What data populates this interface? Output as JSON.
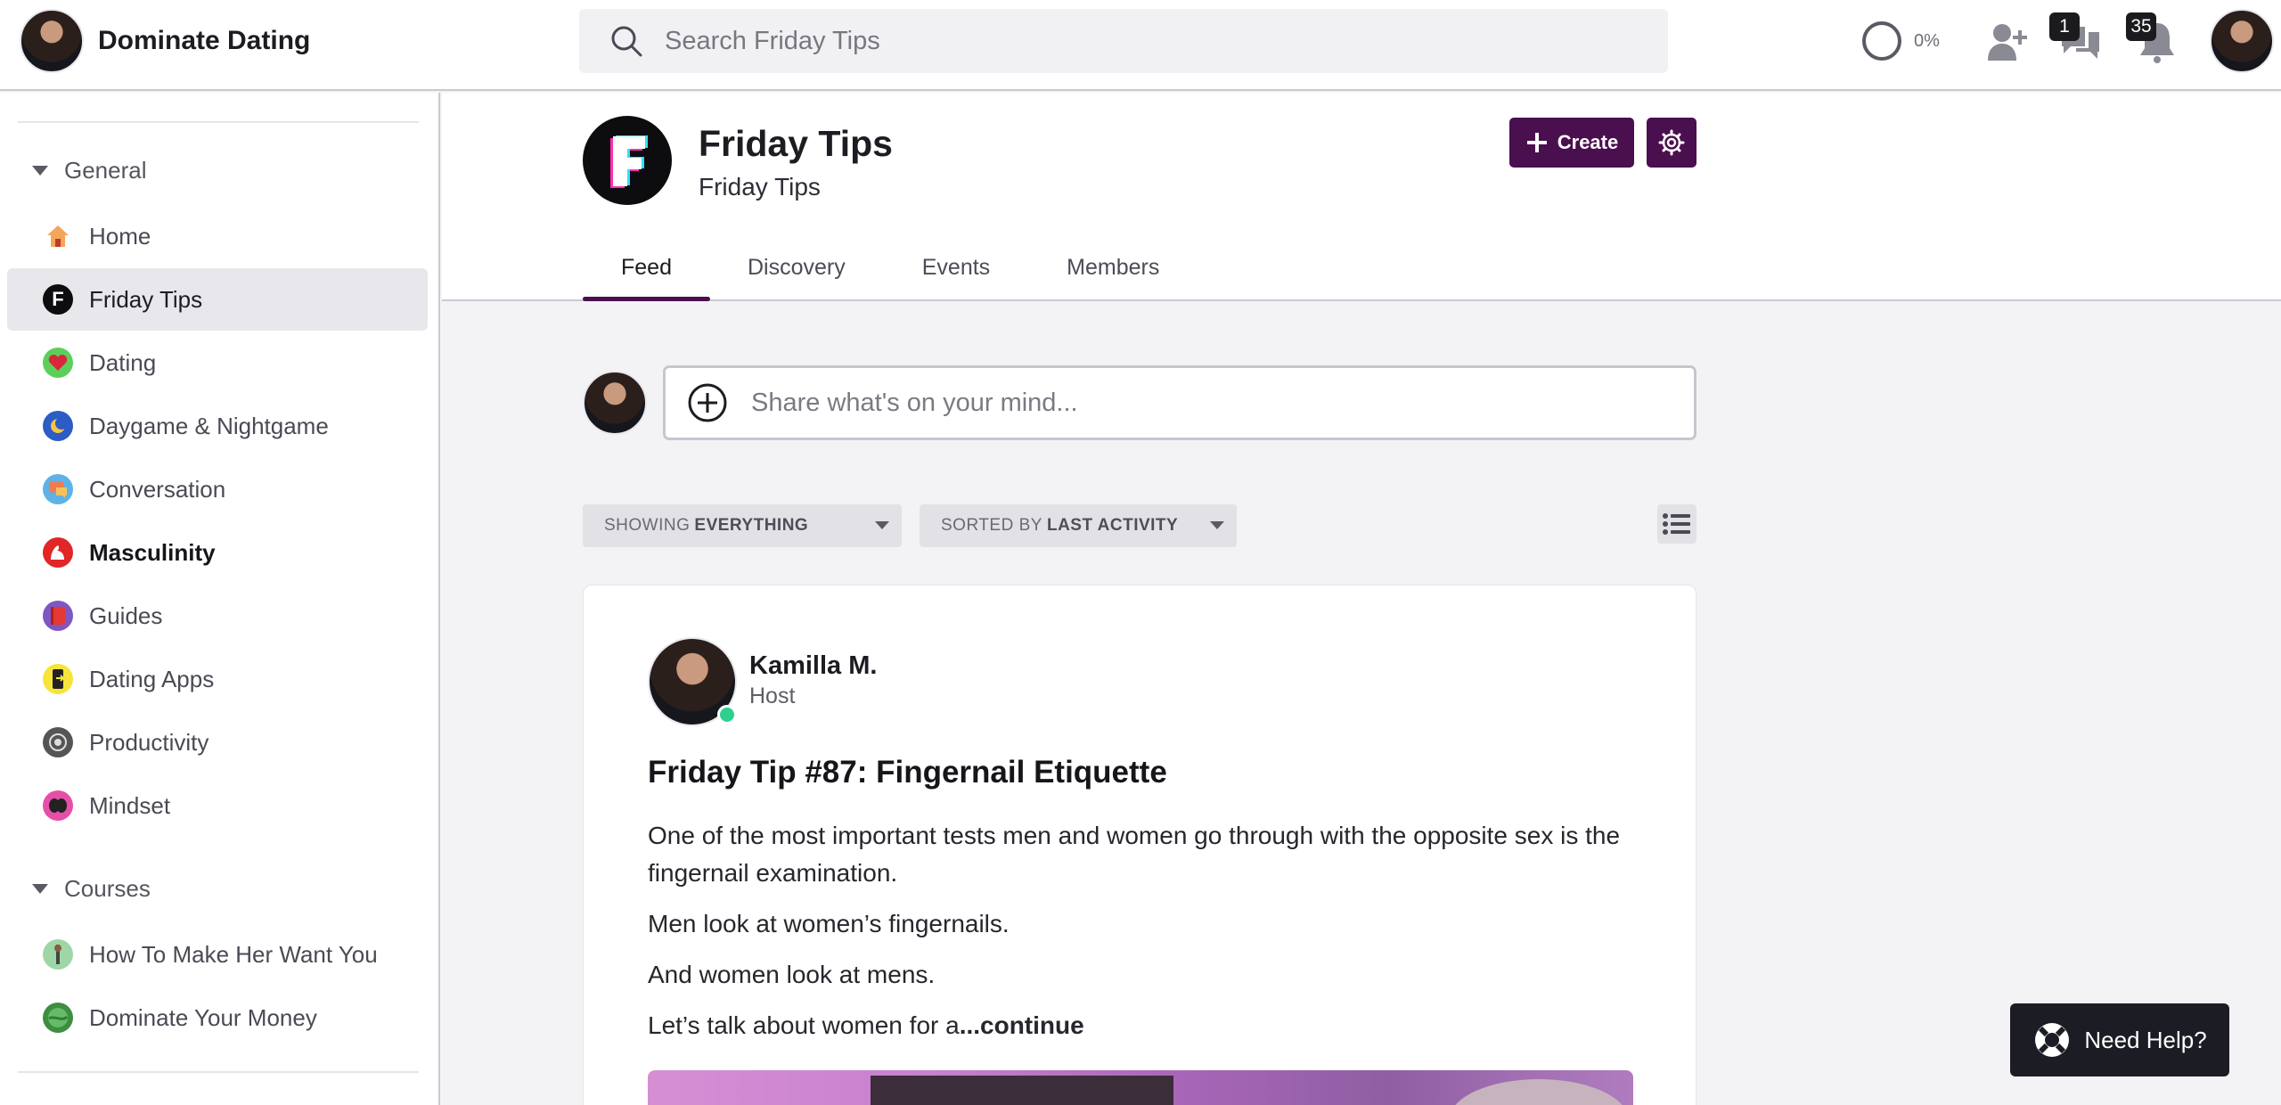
{
  "app": {
    "name": "Dominate Dating"
  },
  "search": {
    "placeholder": "Search Friday Tips"
  },
  "header": {
    "progress_label": "0%",
    "messages_badge": "1",
    "notifications_badge": "35"
  },
  "sidebar": {
    "sections": [
      {
        "label": "General"
      },
      {
        "label": "Courses"
      }
    ],
    "general_items": [
      {
        "label": "Home",
        "icon": "house-icon"
      },
      {
        "label": "Friday Tips",
        "icon": "friday-tips-logo-icon"
      },
      {
        "label": "Dating",
        "icon": "heart-icon"
      },
      {
        "label": "Daygame & Nightgame",
        "icon": "moon-sun-icon"
      },
      {
        "label": "Conversation",
        "icon": "speech-bubble-icon"
      },
      {
        "label": "Masculinity",
        "icon": "flexed-arm-icon"
      },
      {
        "label": "Guides",
        "icon": "book-icon"
      },
      {
        "label": "Dating Apps",
        "icon": "phone-icon"
      },
      {
        "label": "Productivity",
        "icon": "gear-cycle-icon"
      },
      {
        "label": "Mindset",
        "icon": "brain-icon"
      }
    ],
    "course_items": [
      {
        "label": "How To Make Her Want You",
        "icon": "course-thumb-icon"
      },
      {
        "label": "Dominate Your Money",
        "icon": "globe-money-icon"
      }
    ]
  },
  "space": {
    "title": "Friday Tips",
    "subtitle": "Friday Tips",
    "create_label": "Create",
    "tabs": [
      {
        "label": "Feed",
        "active": true
      },
      {
        "label": "Discovery"
      },
      {
        "label": "Events"
      },
      {
        "label": "Members"
      }
    ]
  },
  "composer": {
    "placeholder": "Share what's on your mind..."
  },
  "filters": {
    "showing_prefix": "SHOWING",
    "showing_value": "EVERYTHING",
    "sorted_prefix": "SORTED BY",
    "sorted_value": "LAST ACTIVITY"
  },
  "post": {
    "author": "Kamilla M.",
    "role": "Host",
    "title": "Friday Tip #87: Fingernail Etiquette",
    "paragraphs": [
      "One of the most important tests men and women go through with the opposite sex is the fingernail examination.",
      "Men look at women’s fingernails.",
      "And women look at mens."
    ],
    "teaser": "Let’s talk about women for a",
    "continue_label": "...continue"
  },
  "help": {
    "label": "Need Help?"
  },
  "colors": {
    "accent": "#4a0f4e",
    "online": "#2fcf8f",
    "badge": "#1a1a1f"
  }
}
